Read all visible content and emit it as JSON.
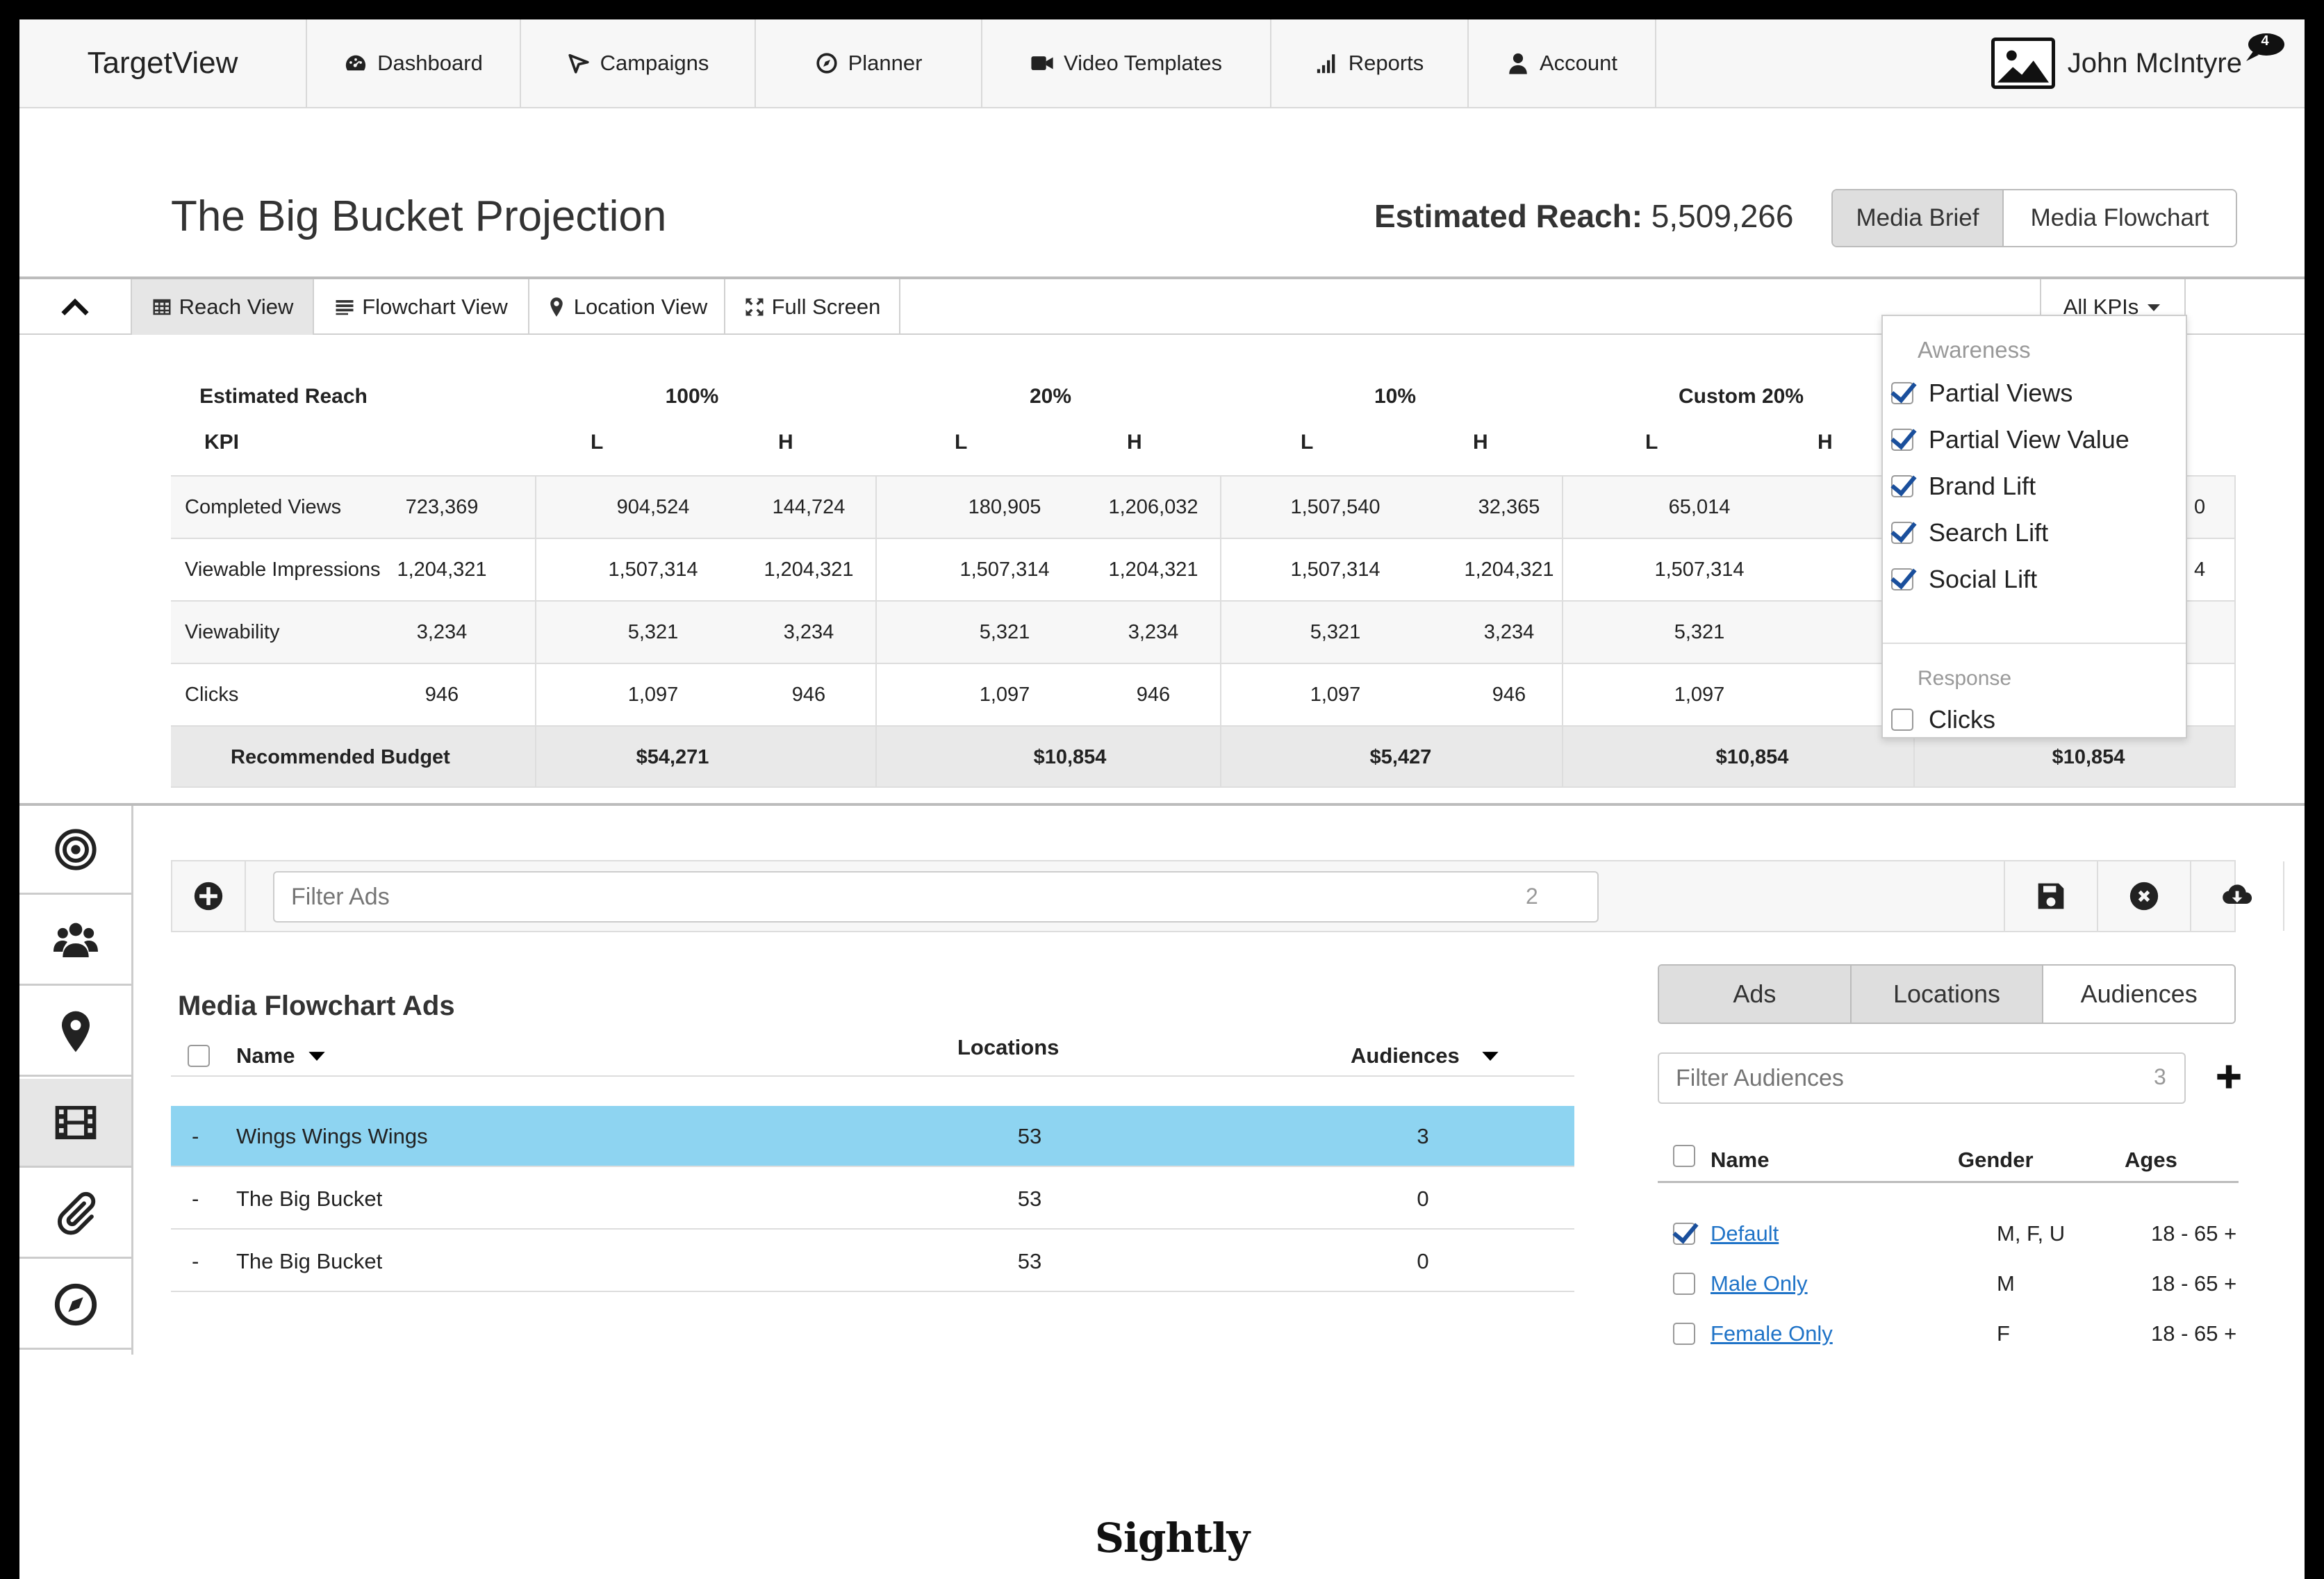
{
  "app": {
    "brand": "TargetView"
  },
  "nav": [
    {
      "label": "Dashboard",
      "icon": "dashboard-icon"
    },
    {
      "label": "Campaigns",
      "icon": "campaigns-icon"
    },
    {
      "label": "Planner",
      "icon": "compass-icon"
    },
    {
      "label": "Video Templates",
      "icon": "video-camera-icon"
    },
    {
      "label": "Reports",
      "icon": "signal-bars-icon"
    },
    {
      "label": "Account",
      "icon": "user-icon"
    }
  ],
  "user": {
    "name": "John McIntyre",
    "notifications": "4"
  },
  "header": {
    "title": "The Big Bucket Projection",
    "reach_label": "Estimated Reach:",
    "reach_value": "5,509,266",
    "media_brief": "Media Brief",
    "media_flowchart": "Media Flowchart"
  },
  "views": {
    "reach": "Reach View",
    "flowchart": "Flowchart View",
    "location": "Location View",
    "fullscreen": "Full Screen",
    "kpi_select": "All KPIs"
  },
  "kpi_table": {
    "estimated_reach": "Estimated Reach",
    "kpi_label": "KPI",
    "groups": [
      "100%",
      "20%",
      "10%",
      "Custom 20%"
    ],
    "low": "L",
    "high": "H",
    "rows": [
      {
        "name": "Completed Views",
        "values": [
          "723,369",
          "904,524",
          "144,724",
          "180,905",
          "1,206,032",
          "1,507,540",
          "32,365",
          "65,014"
        ],
        "hidden_tail": "0"
      },
      {
        "name": "Viewable Impressions",
        "values": [
          "1,204,321",
          "1,507,314",
          "1,204,321",
          "1,507,314",
          "1,204,321",
          "1,507,314",
          "1,204,321",
          "1,507,314"
        ],
        "hidden_tail": "4"
      },
      {
        "name": "Viewability",
        "values": [
          "3,234",
          "5,321",
          "3,234",
          "5,321",
          "3,234",
          "5,321",
          "3,234",
          "5,321"
        ],
        "hidden_tail": ""
      },
      {
        "name": "Clicks",
        "values": [
          "946",
          "1,097",
          "946",
          "1,097",
          "946",
          "1,097",
          "946",
          "1,097"
        ],
        "hidden_tail": ""
      }
    ],
    "budget_label": "Recommended Budget",
    "budgets": [
      "$54,271",
      "$10,854",
      "$5,427",
      "$10,854",
      "$10,854"
    ]
  },
  "kpi_dropdown": {
    "awareness": "Awareness",
    "awareness_items": [
      {
        "label": "Partial Views",
        "checked": true
      },
      {
        "label": "Partial View Value",
        "checked": true
      },
      {
        "label": "Brand Lift",
        "checked": true
      },
      {
        "label": "Search Lift",
        "checked": true
      },
      {
        "label": "Social Lift",
        "checked": true
      }
    ],
    "response": "Response",
    "response_items": [
      {
        "label": "Clicks",
        "checked": false
      }
    ]
  },
  "ads": {
    "filter_placeholder": "Filter Ads",
    "filter_count": "2",
    "section_title": "Media Flowchart Ads",
    "col_name": "Name",
    "col_locations": "Locations",
    "col_audiences": "Audiences",
    "rows": [
      {
        "dash": "-",
        "name": "Wings Wings Wings",
        "locations": "53",
        "audiences": "3",
        "selected": true
      },
      {
        "dash": "-",
        "name": "The Big Bucket",
        "locations": "53",
        "audiences": "0",
        "selected": false
      },
      {
        "dash": "-",
        "name": "The Big Bucket",
        "locations": "53",
        "audiences": "0",
        "selected": false
      }
    ]
  },
  "audiences": {
    "tabs": [
      "Ads",
      "Locations",
      "Audiences"
    ],
    "active_tab": "Audiences",
    "filter_placeholder": "Filter Audiences",
    "filter_count": "3",
    "col_name": "Name",
    "col_gender": "Gender",
    "col_ages": "Ages",
    "rows": [
      {
        "name": "Default",
        "gender": "M, F, U",
        "ages": "18 - 65 +",
        "checked": true
      },
      {
        "name": "Male Only",
        "gender": "M",
        "ages": "18 - 65 +",
        "checked": false
      },
      {
        "name": "Female Only",
        "gender": "F",
        "ages": "18 - 65 +",
        "checked": false
      }
    ]
  },
  "footer": {
    "logo": "Sightly"
  },
  "colors": {
    "selected_row": "#8ed4f1",
    "link": "#1f73c7",
    "check": "#1a4f9c"
  }
}
